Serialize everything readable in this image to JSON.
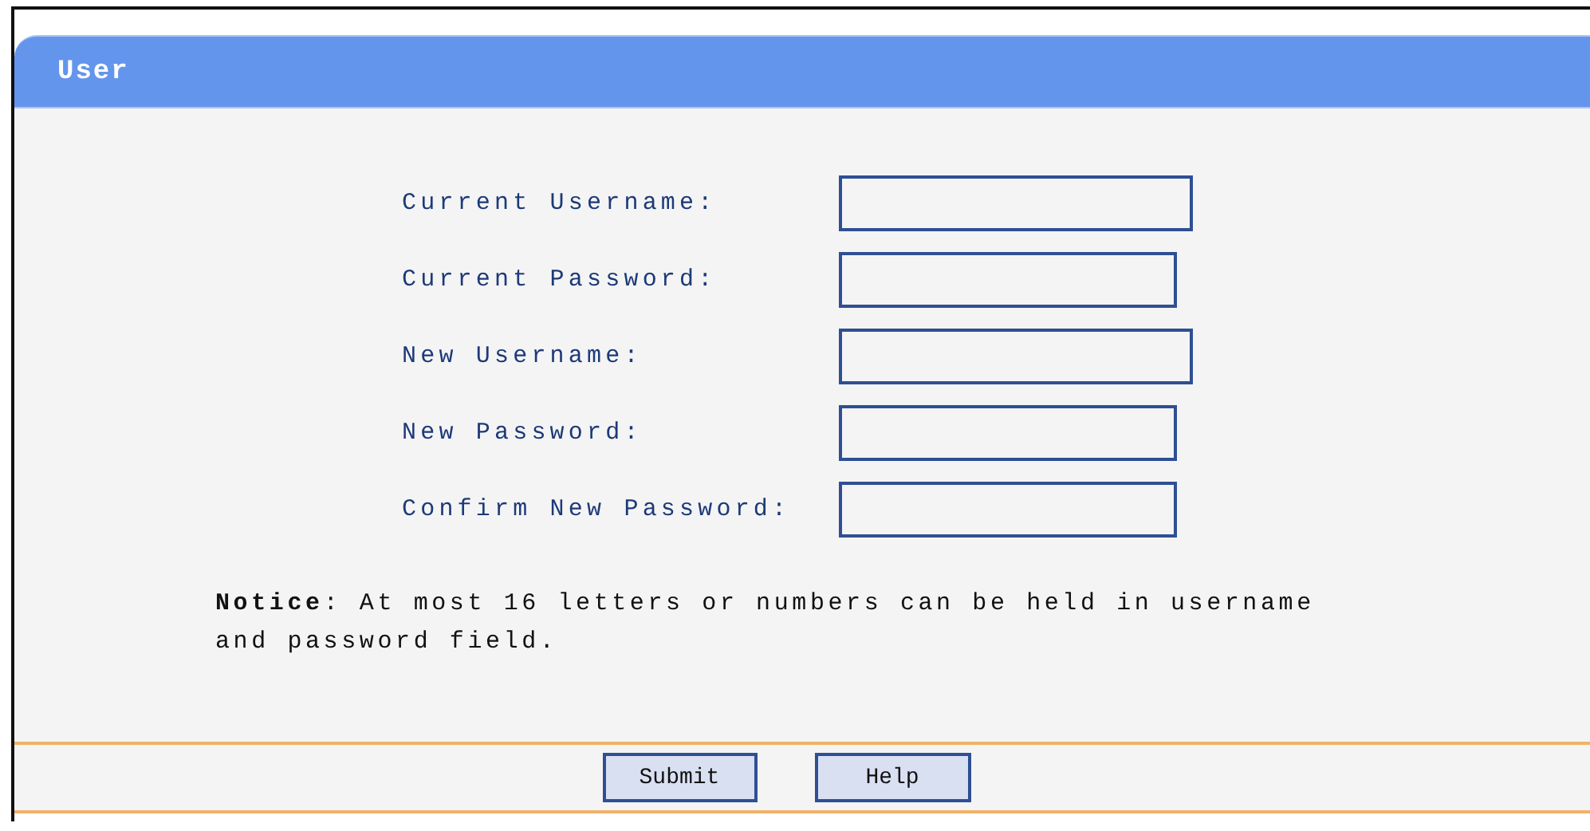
{
  "panel": {
    "title": "User"
  },
  "fields": [
    {
      "label": "Current Username:",
      "kind": "text"
    },
    {
      "label": "Current Password:",
      "kind": "password"
    },
    {
      "label": "New Username:",
      "kind": "text"
    },
    {
      "label": "New Password:",
      "kind": "password"
    },
    {
      "label": "Confirm New Password:",
      "kind": "password"
    }
  ],
  "notice": "**Notice**: At most 16 letters or numbers can be held in username and password field.",
  "buttons": [
    "Submit",
    "Help"
  ]
}
